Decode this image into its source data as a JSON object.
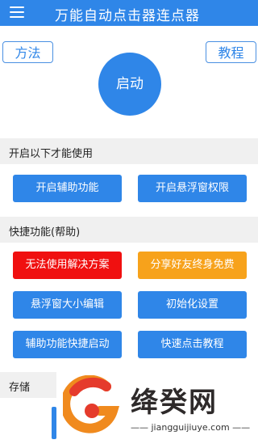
{
  "header": {
    "title": "万能自动点击器连点器",
    "menu_icon": "hamburger-menu-icon"
  },
  "top_buttons": {
    "method_label": "方法",
    "tutorial_label": "教程"
  },
  "start_label": "启动",
  "section_open": {
    "title": "开启以下才能使用",
    "accessibility_label": "开启辅助功能",
    "overlay_permission_label": "开启悬浮窗权限"
  },
  "section_quick": {
    "title": "快捷功能(帮助)",
    "cannot_use_label": "无法使用解决方案",
    "share_label": "分享好友终身免费",
    "window_size_label": "悬浮窗大小编辑",
    "init_label": "初始化设置",
    "quick_start_label": "辅助功能快捷启动",
    "quick_click_tutorial_label": "快速点击教程"
  },
  "section_storage": {
    "title": "存储"
  },
  "watermark": {
    "name": "绛癸网",
    "url": "—— jiangguijiuye.com ——"
  },
  "colors": {
    "primary": "#2f86e8",
    "red": "#f01010",
    "orange": "#f7a21b"
  }
}
